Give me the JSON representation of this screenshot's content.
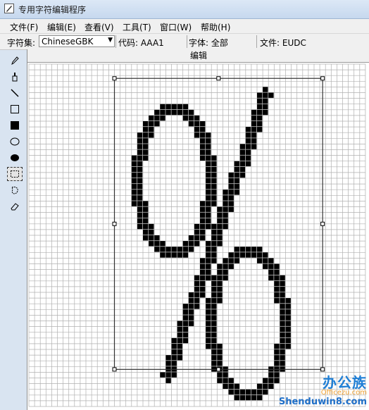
{
  "window": {
    "title": "专用字符编辑程序"
  },
  "menu": [
    "文件(F)",
    "编辑(E)",
    "查看(V)",
    "工具(T)",
    "窗口(W)",
    "帮助(H)"
  ],
  "infobar": {
    "charset_label": "字符集:",
    "charset_value": "ChineseGBK",
    "code": "代码: AAA1",
    "font": "字体: 全部",
    "file": "文件: EUDC"
  },
  "tools": [
    "pencil-tool",
    "brush-tool",
    "line-tool",
    "hollow-rectangle-tool",
    "filled-rectangle-tool",
    "hollow-ellipse-tool",
    "filled-ellipse-tool",
    "rectangle-select-tool",
    "freeform-select-tool",
    "eraser-tool"
  ],
  "selected_tool": "rectangle-select-tool",
  "editor": {
    "header": "编辑",
    "glyph": "%"
  },
  "watermark": {
    "logo": "办公族",
    "sub": "Officezu.com",
    "site": "Shenduwin8.com"
  },
  "colors": {
    "pixel_on": "#000000",
    "grid_line": "#b0b0b0",
    "selection": "#333333"
  }
}
